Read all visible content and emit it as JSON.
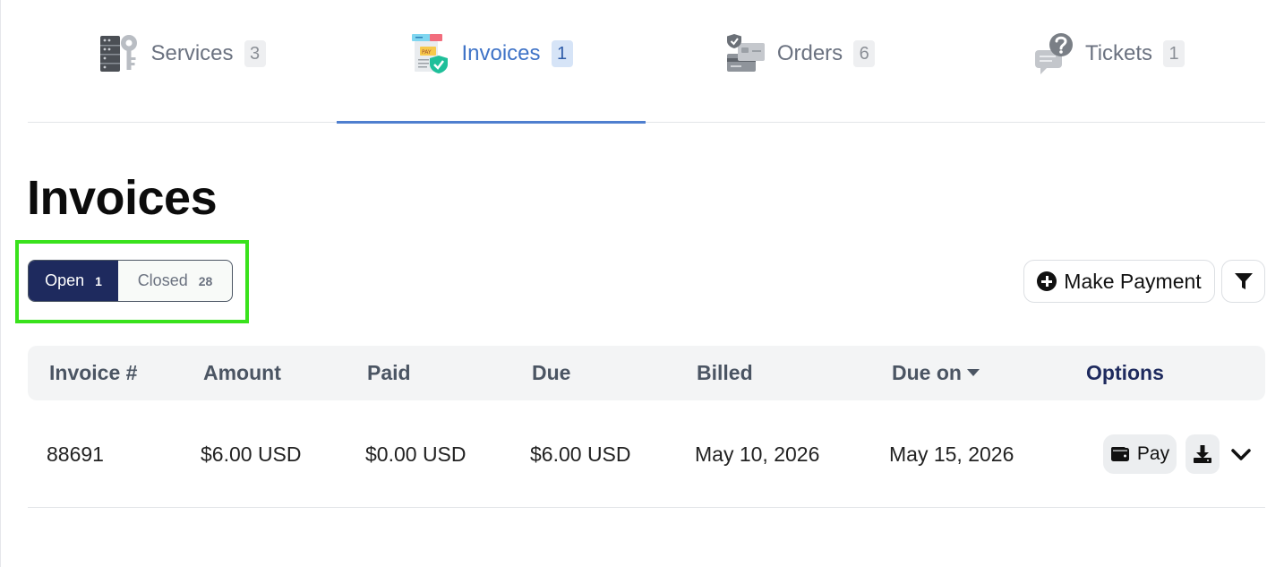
{
  "tabs": [
    {
      "label": "Services",
      "count": "3",
      "icon": "services-icon",
      "active": false
    },
    {
      "label": "Invoices",
      "count": "1",
      "icon": "invoices-icon",
      "active": true
    },
    {
      "label": "Orders",
      "count": "6",
      "icon": "orders-icon",
      "active": false
    },
    {
      "label": "Tickets",
      "count": "1",
      "icon": "tickets-icon",
      "active": false
    }
  ],
  "page": {
    "title": "Invoices"
  },
  "status_filter": {
    "open": {
      "label": "Open",
      "count": "1",
      "selected": true
    },
    "closed": {
      "label": "Closed",
      "count": "28",
      "selected": false
    }
  },
  "actions": {
    "make_payment_label": "Make Payment",
    "make_payment_icon": "plus-circle-icon",
    "filter_icon": "filter-icon"
  },
  "table": {
    "headers": {
      "invoice": "Invoice #",
      "amount": "Amount",
      "paid": "Paid",
      "due": "Due",
      "billed": "Billed",
      "due_on": "Due on",
      "options": "Options"
    },
    "sort": {
      "column": "due_on",
      "direction": "descending"
    },
    "rows": [
      {
        "invoice": "88691",
        "amount": "$6.00 USD",
        "paid": "$0.00 USD",
        "due": "$6.00 USD",
        "billed": "May 10, 2026",
        "due_on": "May 15, 2026",
        "pay_label": "Pay"
      }
    ]
  },
  "colors": {
    "accent": "#3f73c7",
    "navy": "#1e2a5e",
    "highlight": "#39e21c",
    "muted_text": "#6b7280"
  }
}
